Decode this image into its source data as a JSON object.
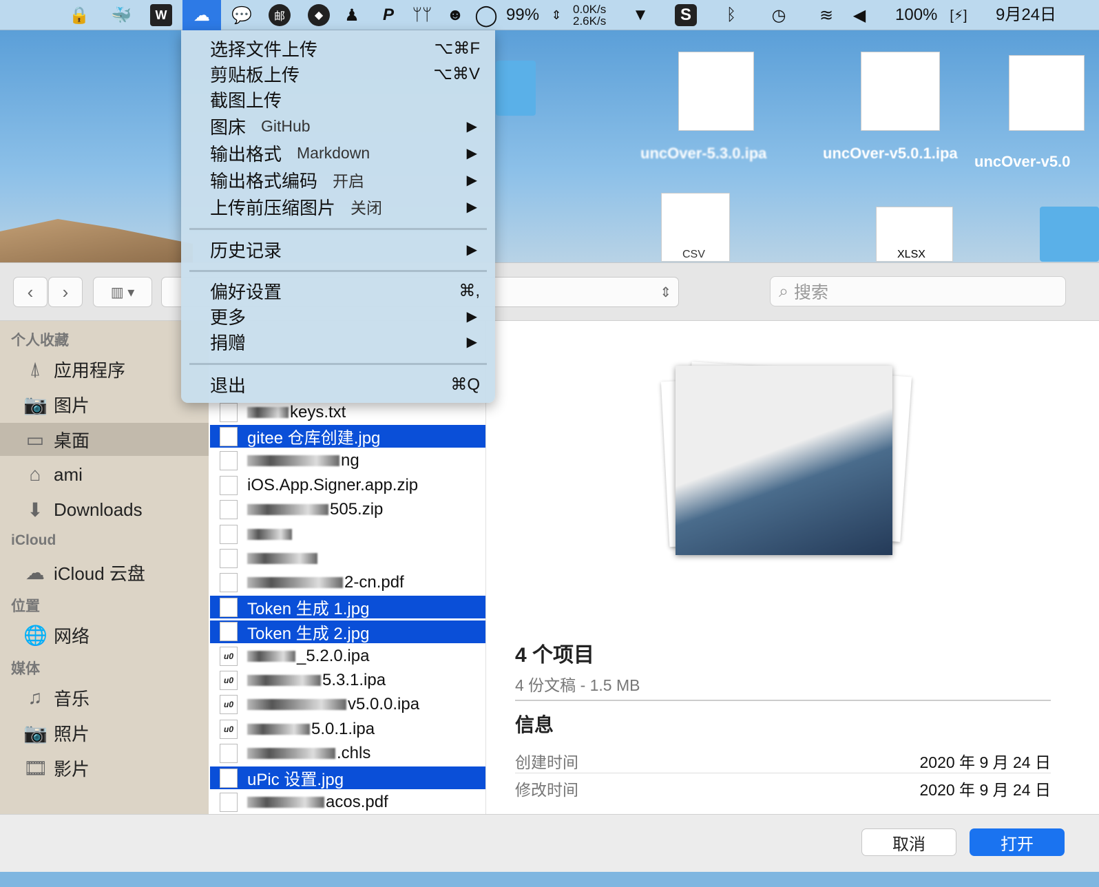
{
  "menubar": {
    "battery_pct": "99%",
    "net_up": "0.0K/s",
    "net_down": "2.6K/s",
    "battery": "100%",
    "date": "9月24日",
    "icons": [
      "vpn-lock-icon",
      "docker-icon",
      "wps-icon",
      "upic-cloud-upload-icon",
      "wechat-icon",
      "mail-icon",
      "dingtalk-icon",
      "qq-penguin-icon",
      "p-app-icon",
      "airpods-icon",
      "owl-icon",
      "circle-icon"
    ]
  },
  "desktop": {
    "labels": [
      "uncOver-5.3.0.ipa",
      "uncOver-v5.0.1.ipa",
      "uncOver-v5.0",
      "XLSX",
      "CSV"
    ]
  },
  "menu": {
    "items": [
      {
        "label": "选择文件上传",
        "shortcut": "⌥⌘F"
      },
      {
        "label": "剪贴板上传",
        "shortcut": "⌥⌘V"
      },
      {
        "label": "截图上传"
      },
      {
        "label": "图床",
        "value": "GitHub",
        "arrow": "▶"
      },
      {
        "label": "输出格式",
        "value": "Markdown",
        "arrow": "▶"
      },
      {
        "label": "输出格式编码",
        "value": "开启",
        "arrow": "▶"
      },
      {
        "label": "上传前压缩图片",
        "value": "关闭",
        "arrow": "▶"
      },
      {
        "label": "历史记录",
        "arrow": "▶"
      },
      {
        "label": "偏好设置",
        "shortcut": "⌘,"
      },
      {
        "label": "更多",
        "arrow": "▶"
      },
      {
        "label": "捐赠",
        "arrow": "▶"
      },
      {
        "label": "退出",
        "shortcut": "⌘Q"
      }
    ]
  },
  "toolbar": {
    "back": "‹",
    "forward": "›",
    "view": "▥ ▾",
    "search_placeholder": "搜索"
  },
  "sidebar": {
    "sections": [
      {
        "title": "个人收藏",
        "items": [
          {
            "label": "应用程序",
            "icon": "⍋"
          },
          {
            "label": "图片",
            "icon": "📷"
          },
          {
            "label": "桌面",
            "icon": "▭"
          },
          {
            "label": "ami",
            "icon": "⌂"
          },
          {
            "label": "Downloads",
            "icon": "⬇"
          }
        ]
      },
      {
        "title": "iCloud",
        "items": [
          {
            "label": "iCloud 云盘",
            "icon": "☁"
          }
        ]
      },
      {
        "title": "位置",
        "items": [
          {
            "label": "网络",
            "icon": "🌐"
          }
        ]
      },
      {
        "title": "媒体",
        "items": [
          {
            "label": "音乐",
            "icon": "♫"
          },
          {
            "label": "照片",
            "icon": "📷"
          },
          {
            "label": "影片",
            "icon": "🎞"
          }
        ]
      }
    ]
  },
  "files": [
    {
      "name": "keys.txt",
      "blur": true
    },
    {
      "name": "gitee 仓库创建.jpg",
      "sel": true
    },
    {
      "name": "ng",
      "blur": true
    },
    {
      "name": "iOS.App.Signer.app.zip"
    },
    {
      "name": "505.zip",
      "blur": true
    },
    {
      "name": "",
      "blur": true
    },
    {
      "name": "",
      "blur": true
    },
    {
      "name": "2-cn.pdf",
      "blur": true
    },
    {
      "name": "Token 生成 1.jpg",
      "sel": true
    },
    {
      "name": "Token 生成 2.jpg",
      "sel": true
    },
    {
      "name": "_5.2.0.ipa",
      "blur": true,
      "icon": "u0"
    },
    {
      "name": "5.3.1.ipa",
      "blur": true,
      "icon": "u0"
    },
    {
      "name": "v5.0.0.ipa",
      "blur": true,
      "icon": "u0"
    },
    {
      "name": "5.0.1.ipa",
      "blur": true,
      "icon": "u0"
    },
    {
      "name": ".chls",
      "blur": true
    },
    {
      "name": "uPic 设置.jpg",
      "sel": true
    },
    {
      "name": "acos.pdf",
      "blur": true
    }
  ],
  "preview": {
    "title": "4 个项目",
    "subtitle": "4 份文稿 - 1.5 MB",
    "info_title": "信息",
    "created_label": "创建时间",
    "created": "2020 年 9 月 24 日",
    "modified_label": "修改时间",
    "modified": "2020 年 9 月 24 日"
  },
  "buttons": {
    "cancel": "取消",
    "open": "打开"
  },
  "colors": {
    "accent": "#0a4fd8",
    "menubar": "#bcd9ee"
  }
}
